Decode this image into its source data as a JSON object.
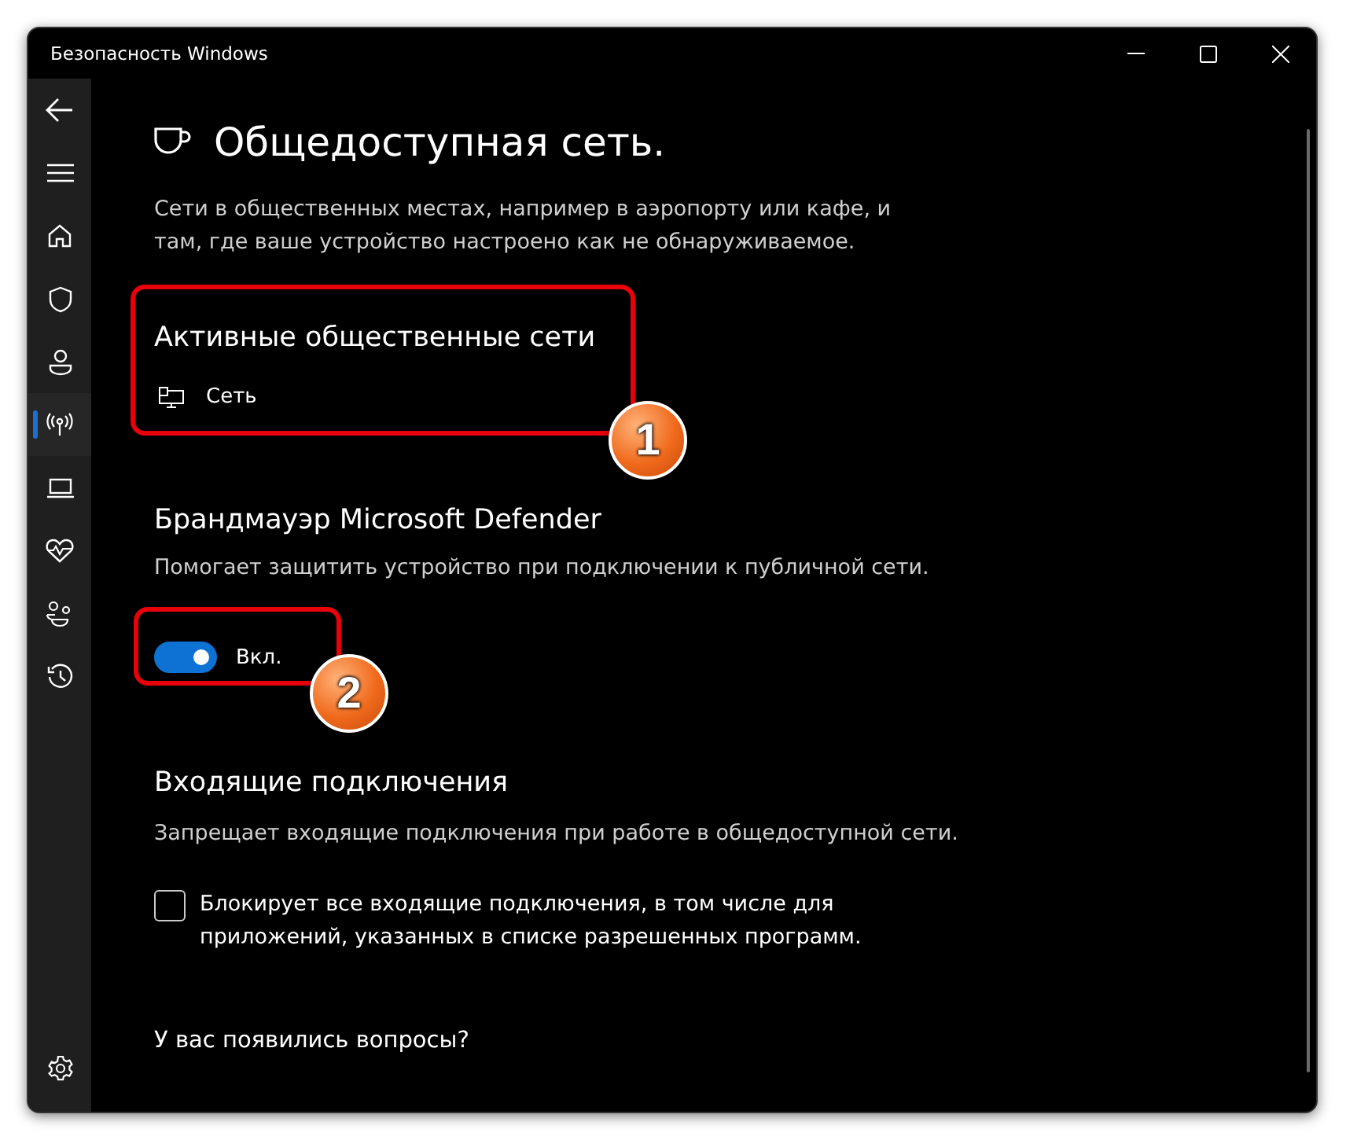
{
  "window": {
    "title": "Безопасность Windows"
  },
  "sidebar": {
    "items": [
      {
        "kind": "back",
        "selected": false
      },
      {
        "kind": "menu",
        "selected": false
      },
      {
        "kind": "home",
        "selected": false
      },
      {
        "kind": "shield",
        "selected": false
      },
      {
        "kind": "person",
        "selected": false
      },
      {
        "kind": "antenna",
        "selected": true
      },
      {
        "kind": "laptop",
        "selected": false
      },
      {
        "kind": "heart",
        "selected": false
      },
      {
        "kind": "family",
        "selected": false
      },
      {
        "kind": "history",
        "selected": false
      }
    ],
    "bottom": [
      {
        "kind": "settings",
        "selected": false
      }
    ]
  },
  "page": {
    "title": "Общедоступная сеть.",
    "description": "Сети в общественных местах, например в аэропорту или кафе, и там, где ваше устройство настроено как не обнаруживаемое."
  },
  "active_networks": {
    "heading": "Активные общественные сети",
    "networks": [
      "Сеть"
    ]
  },
  "firewall": {
    "heading": "Брандмауэр Microsoft Defender",
    "description": "Помогает защитить устройство при подключении к публичной сети.",
    "toggle": {
      "on": true,
      "label": "Вкл."
    }
  },
  "incoming": {
    "heading": "Входящие подключения",
    "description": "Запрещает входящие подключения при работе в общедоступной сети.",
    "checkbox": {
      "checked": false,
      "label": "Блокирует все входящие подключения, в том числе для приложений, указанных в списке разрешенных программ."
    }
  },
  "help": {
    "heading": "У вас появились вопросы?"
  },
  "annotations": [
    {
      "number": "1"
    },
    {
      "number": "2"
    }
  ]
}
